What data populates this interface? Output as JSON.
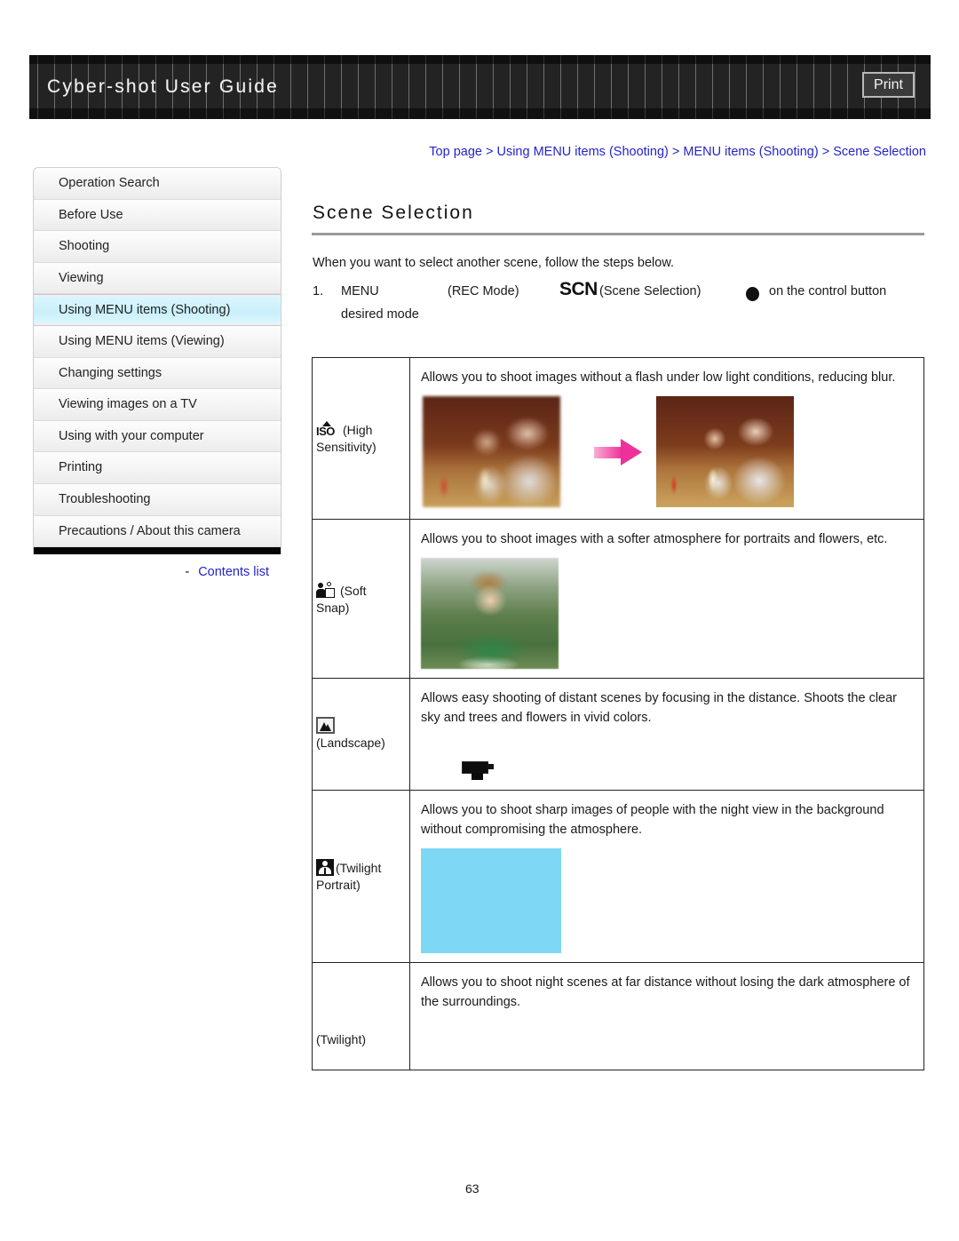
{
  "header": {
    "title": "Cyber-shot User Guide",
    "print_label": "Print"
  },
  "breadcrumb": {
    "full": "Top page > Using MENU items (Shooting) > MENU items (Shooting) > Scene Selection",
    "items": [
      "Top page",
      "Using MENU items (Shooting)",
      "MENU items (Shooting)",
      "Scene Selection"
    ],
    "separator": ">"
  },
  "sidebar": {
    "items": [
      {
        "label": "Operation Search",
        "active": false
      },
      {
        "label": "Before Use",
        "active": false
      },
      {
        "label": "Shooting",
        "active": false
      },
      {
        "label": "Viewing",
        "active": false
      },
      {
        "label": "Using MENU items (Shooting)",
        "active": true
      },
      {
        "label": "Using MENU items (Viewing)",
        "active": false
      },
      {
        "label": "Changing settings",
        "active": false
      },
      {
        "label": "Viewing images on a TV",
        "active": false
      },
      {
        "label": "Using with your computer",
        "active": false
      },
      {
        "label": "Printing",
        "active": false
      },
      {
        "label": "Troubleshooting",
        "active": false
      },
      {
        "label": "Precautions / About this camera",
        "active": false
      }
    ],
    "contents_link": "Contents list",
    "contents_dash": "-"
  },
  "main": {
    "page_title": "Scene Selection",
    "intro": "When you want to select another scene, follow the steps below.",
    "step": {
      "number": "1.",
      "menu": "MENU",
      "rec_mode": "(REC Mode)",
      "scn_badge": "SCN",
      "scene_selection": "(Scene Selection)",
      "control_button": "on the control button",
      "desired_mode": "desired mode"
    },
    "table": {
      "rows": [
        {
          "icon_name": "iso-high-sensitivity-icon",
          "icon_label": "(High",
          "icon_label2": "Sensitivity)",
          "description": "Allows you to shoot images without a flash under low light conditions, reducing blur.",
          "media": "two-photos-with-arrow"
        },
        {
          "icon_name": "soft-snap-icon",
          "icon_label": "(Soft",
          "icon_label2": "Snap)",
          "description": "Allows you to shoot images with a softer atmosphere for portraits and flowers, etc.",
          "media": "boy-in-grass-photo"
        },
        {
          "icon_name": "landscape-icon",
          "icon_label": "",
          "icon_label2": "(Landscape)",
          "description": "Allows easy shooting of distant scenes by focusing in the distance. Shoots the clear sky and trees and flowers in vivid colors.",
          "media": "broken-image-placeholder"
        },
        {
          "icon_name": "twilight-portrait-icon",
          "icon_label": "(Twilight",
          "icon_label2": "Portrait)",
          "description": "Allows you to shoot sharp images of people with the night view in the background without compromising the atmosphere.",
          "media": "blue-placeholder-block"
        },
        {
          "icon_name": "twilight-icon",
          "icon_label": "",
          "icon_label2": "(Twilight)",
          "description": "Allows you to shoot night scenes at far distance without losing the dark atmosphere of the surroundings.",
          "media": "none"
        }
      ]
    },
    "page_number": "63"
  },
  "colors": {
    "link": "#2424c8",
    "header_bg": "#232323",
    "active_item": "#c9f0fb",
    "arrow": "#ef2f9a",
    "blue_block": "#7ed8f5"
  }
}
